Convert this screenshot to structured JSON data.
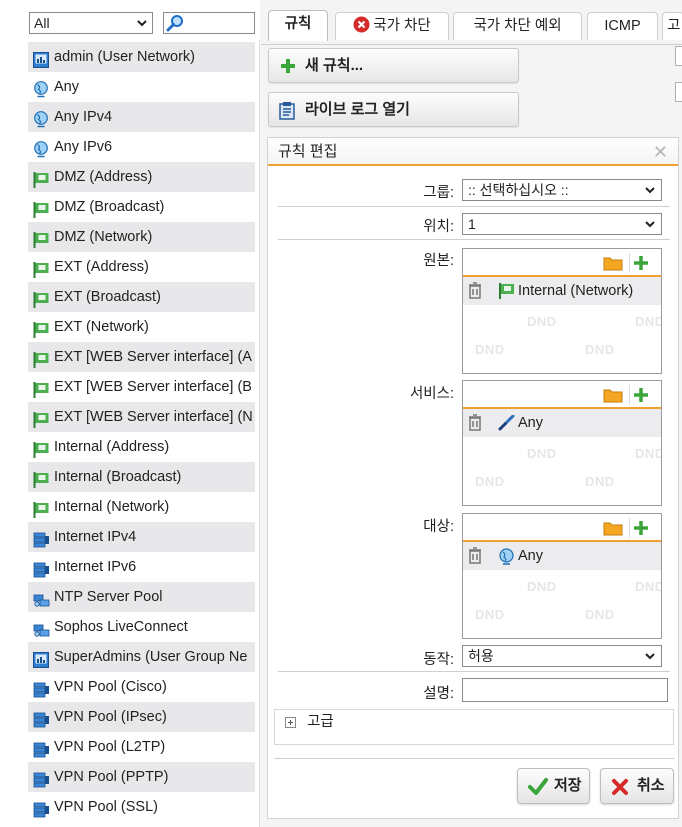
{
  "left_panel": {
    "filter": {
      "selected": "All"
    },
    "objects": [
      {
        "label": "admin (User Network)",
        "icon": "user-network-icon"
      },
      {
        "label": "Any",
        "icon": "globe-icon"
      },
      {
        "label": "Any IPv4",
        "icon": "globe-icon"
      },
      {
        "label": "Any IPv6",
        "icon": "globe-icon"
      },
      {
        "label": "DMZ (Address)",
        "icon": "interface-flag-icon"
      },
      {
        "label": "DMZ (Broadcast)",
        "icon": "interface-flag-icon"
      },
      {
        "label": "DMZ (Network)",
        "icon": "interface-flag-icon"
      },
      {
        "label": "EXT (Address)",
        "icon": "interface-flag-icon"
      },
      {
        "label": "EXT (Broadcast)",
        "icon": "interface-flag-icon"
      },
      {
        "label": "EXT (Network)",
        "icon": "interface-flag-icon"
      },
      {
        "label": "EXT [WEB Server interface] (A",
        "icon": "interface-flag-icon"
      },
      {
        "label": "EXT [WEB Server interface] (B",
        "icon": "interface-flag-icon"
      },
      {
        "label": "EXT [WEB Server interface] (N",
        "icon": "interface-flag-icon"
      },
      {
        "label": "Internal (Address)",
        "icon": "interface-flag-icon"
      },
      {
        "label": "Internal (Broadcast)",
        "icon": "interface-flag-icon"
      },
      {
        "label": "Internal (Network)",
        "icon": "interface-flag-icon"
      },
      {
        "label": "Internet IPv4",
        "icon": "server-network-icon"
      },
      {
        "label": "Internet IPv6",
        "icon": "server-network-icon"
      },
      {
        "label": "NTP Server Pool",
        "icon": "server-pool-icon"
      },
      {
        "label": "Sophos LiveConnect",
        "icon": "server-pool-icon"
      },
      {
        "label": "SuperAdmins (User Group Ne",
        "icon": "user-network-icon"
      },
      {
        "label": "VPN Pool (Cisco)",
        "icon": "server-network-icon"
      },
      {
        "label": "VPN Pool (IPsec)",
        "icon": "server-network-icon"
      },
      {
        "label": "VPN Pool (L2TP)",
        "icon": "server-network-icon"
      },
      {
        "label": "VPN Pool (PPTP)",
        "icon": "server-network-icon"
      },
      {
        "label": "VPN Pool (SSL)",
        "icon": "server-network-icon"
      }
    ]
  },
  "tabs": [
    "규칙",
    "국가 차단",
    "국가 차단 예외",
    "ICMP",
    "고"
  ],
  "buttons": {
    "new_rule": "새 규칙...",
    "live_log": "라이브 로그 열기"
  },
  "edit_panel": {
    "title": "규칙 편집",
    "group_label": "그룹:",
    "group_value": ":: 선택하십시오 ::",
    "position_label": "위치:",
    "position_value": "1",
    "source_label": "원본:",
    "source_item": "Internal (Network)",
    "service_label": "서비스:",
    "service_item": "Any",
    "destination_label": "대상:",
    "destination_item": "Any",
    "action_label": "동작:",
    "action_value": "허용",
    "comment_label": "설명:",
    "comment_value": "",
    "advanced_label": "고급",
    "dnd_text": "DND",
    "save": "저장",
    "cancel": "취소"
  },
  "colors": {
    "accent_orange": "#f0a030",
    "green": "#3aa63a",
    "red": "#d42a2a"
  }
}
